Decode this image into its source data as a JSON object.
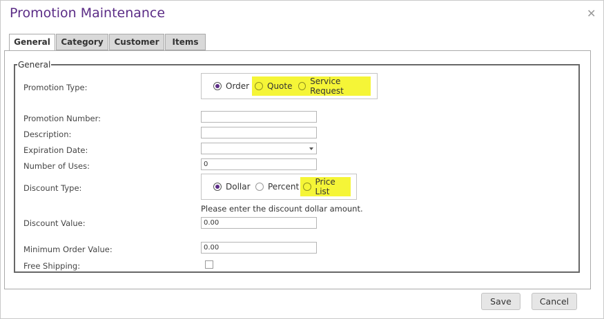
{
  "dialog": {
    "title": "Promotion Maintenance",
    "close_icon": "close-icon"
  },
  "tabs": [
    {
      "label": "General",
      "active": true
    },
    {
      "label": "Category",
      "active": false
    },
    {
      "label": "Customer",
      "active": false
    },
    {
      "label": "Items",
      "active": false
    }
  ],
  "fieldset": {
    "legend": "General"
  },
  "promotion_type": {
    "label": "Promotion Type:",
    "options": [
      {
        "label": "Order",
        "checked": true
      },
      {
        "label": "Quote",
        "checked": false,
        "highlighted": true
      },
      {
        "label": "Service Request",
        "checked": false,
        "highlighted": true
      }
    ]
  },
  "fields": {
    "promotion_number": {
      "label": "Promotion Number:",
      "value": ""
    },
    "description": {
      "label": "Description:",
      "value": ""
    },
    "expiration_date": {
      "label": "Expiration Date:",
      "value": ""
    },
    "number_of_uses": {
      "label": "Number of Uses:",
      "value": "0"
    },
    "discount_value": {
      "label": "Discount Value:",
      "value": "0.00"
    },
    "minimum_order_value": {
      "label": "Minimum Order Value:",
      "value": "0.00"
    },
    "free_shipping": {
      "label": "Free Shipping:",
      "checked": false
    }
  },
  "discount_type": {
    "label": "Discount Type:",
    "options": [
      {
        "label": "Dollar",
        "checked": true
      },
      {
        "label": "Percent",
        "checked": false
      },
      {
        "label": "Price List",
        "checked": false,
        "highlighted": true
      }
    ],
    "hint": "Please enter the discount dollar amount."
  },
  "buttons": {
    "save": "Save",
    "cancel": "Cancel"
  },
  "colors": {
    "title": "#5b2c86",
    "highlight": "#f5f537",
    "radio_dot": "#5b2c86"
  }
}
